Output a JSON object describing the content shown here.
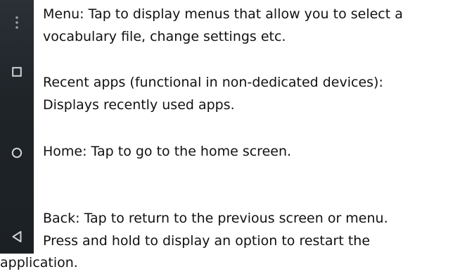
{
  "nav_icons": [
    {
      "icon": "more-vert-icon",
      "color": "#9aa0a6"
    },
    {
      "icon": "square-icon",
      "color": "#d0d3d6"
    },
    {
      "icon": "circle-icon",
      "color": "#d0d3d6"
    },
    {
      "icon": "triangle-left-icon",
      "color": "#d0d3d6"
    }
  ],
  "descriptions": {
    "menu": {
      "line1": "Menu: Tap to display menus that allow you to select a",
      "line2": "vocabulary file, change settings etc."
    },
    "recent": {
      "line1": "Recent apps (functional in non-dedicated devices):",
      "line2": "Displays recently used apps."
    },
    "home": {
      "line1": "Home: Tap to go to the home screen."
    },
    "back": {
      "line1": "Back: Tap to return to the previous screen or menu.",
      "line2": "Press and hold to display an option to restart the",
      "line3": "application."
    }
  }
}
